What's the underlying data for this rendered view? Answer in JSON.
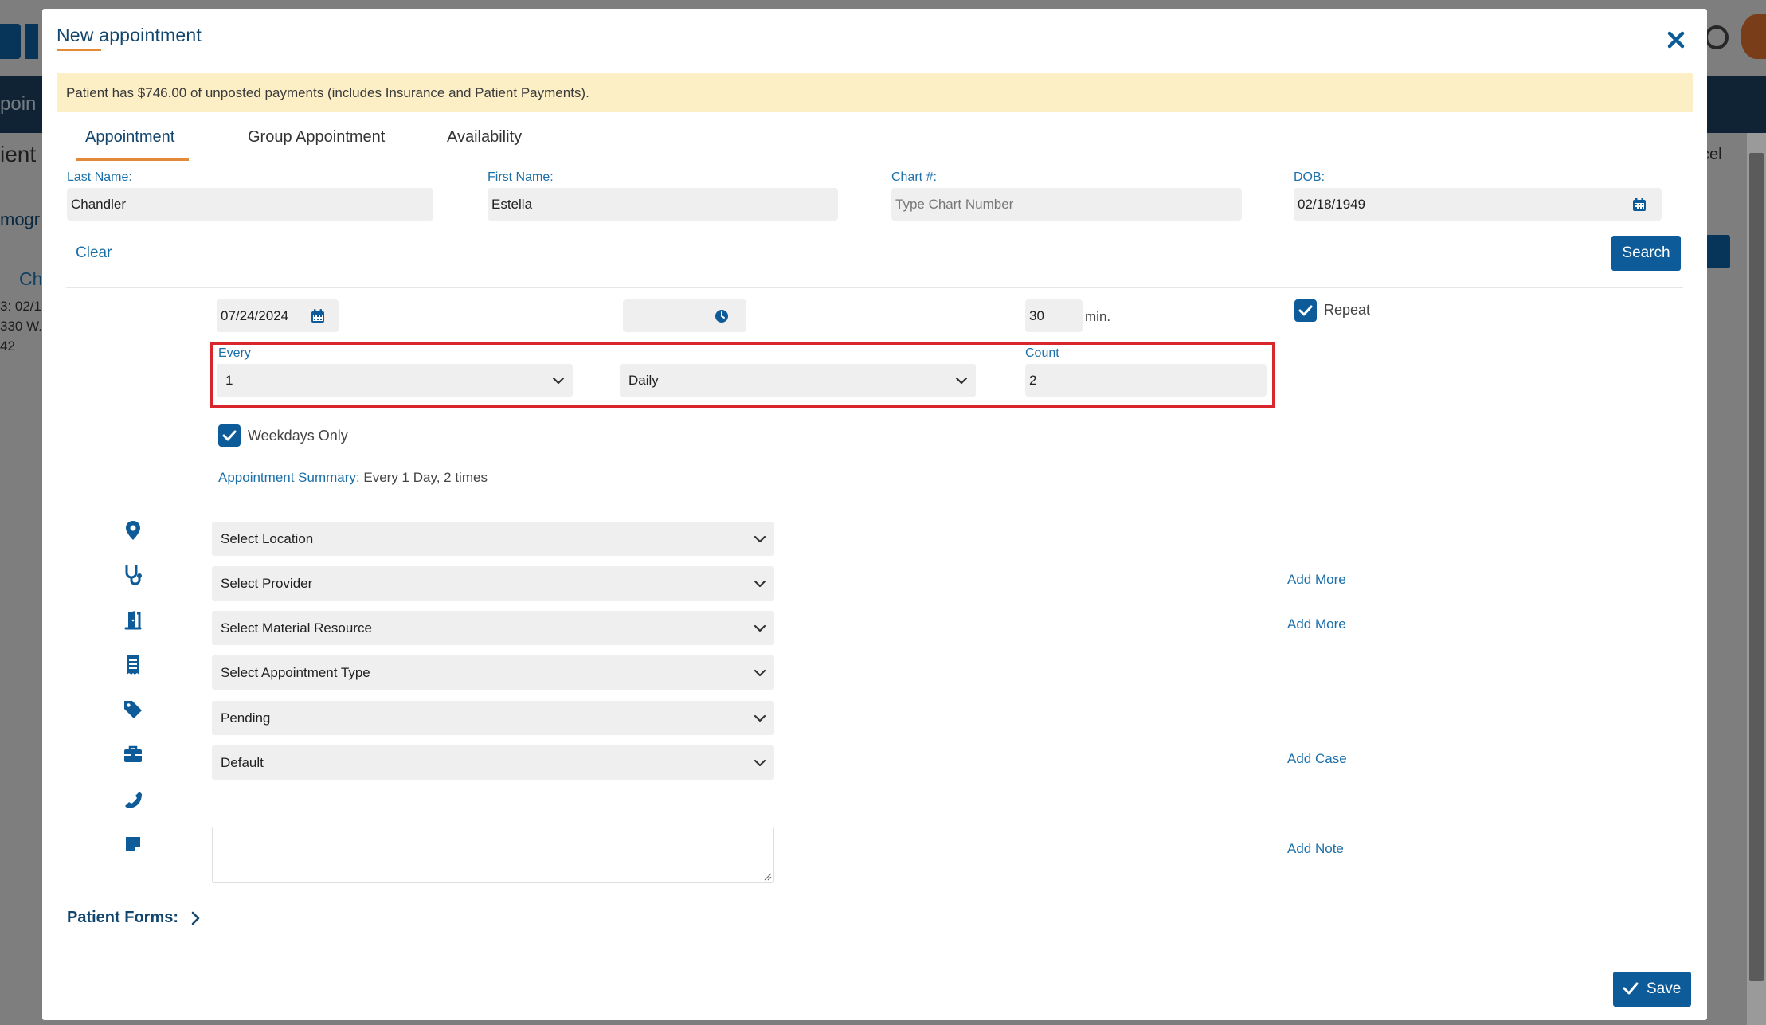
{
  "modal": {
    "title": "New appointment",
    "alert": "Patient has $746.00 of unposted payments (includes Insurance and Patient Payments).",
    "tabs": [
      {
        "label": "Appointment",
        "active": true
      },
      {
        "label": "Group Appointment",
        "active": false
      },
      {
        "label": "Availability",
        "active": false
      }
    ]
  },
  "patient": {
    "last_name_label": "Last Name:",
    "last_name_value": "Chandler",
    "first_name_label": "First Name:",
    "first_name_value": "Estella",
    "chart_label": "Chart #:",
    "chart_value": "",
    "chart_placeholder": "Type Chart Number",
    "dob_label": "DOB:",
    "dob_value": "02/18/1949",
    "clear_label": "Clear",
    "search_label": "Search"
  },
  "schedule": {
    "date": "07/24/2024",
    "time": "",
    "duration": "30",
    "duration_unit": "min.",
    "repeat_label": "Repeat",
    "repeat_checked": true,
    "every_label": "Every",
    "every_value": "1",
    "frequency_value": "Daily",
    "count_label": "Count",
    "count_value": "2",
    "weekdays_label": "Weekdays Only",
    "weekdays_checked": true,
    "summary_key": "Appointment Summary:",
    "summary_value": "Every 1 Day, 2 times"
  },
  "details": {
    "location": "Select Location",
    "provider": "Select Provider",
    "material_resource": "Select Material Resource",
    "appointment_type": "Select Appointment Type",
    "status": "Pending",
    "case": "Default",
    "add_more_provider": "Add More",
    "add_more_resource": "Add More",
    "add_case": "Add Case",
    "add_note": "Add Note"
  },
  "footer": {
    "patient_forms": "Patient Forms:",
    "save_label": "Save"
  },
  "background": {
    "frag_nav": "poin",
    "frag_title": "ient",
    "frag_tab": "mogr",
    "frag_name": "Ch",
    "frag_dob": "3: 02/1",
    "frag_addr": "330 W.",
    "frag_num": "42",
    "frag_cancel": "cel"
  },
  "colors": {
    "primary": "#0d5c99",
    "link": "#1b6fa8",
    "accent_underline": "#e38a3a",
    "alert_bg": "#fcefc6",
    "highlight_border": "#d9262c"
  }
}
